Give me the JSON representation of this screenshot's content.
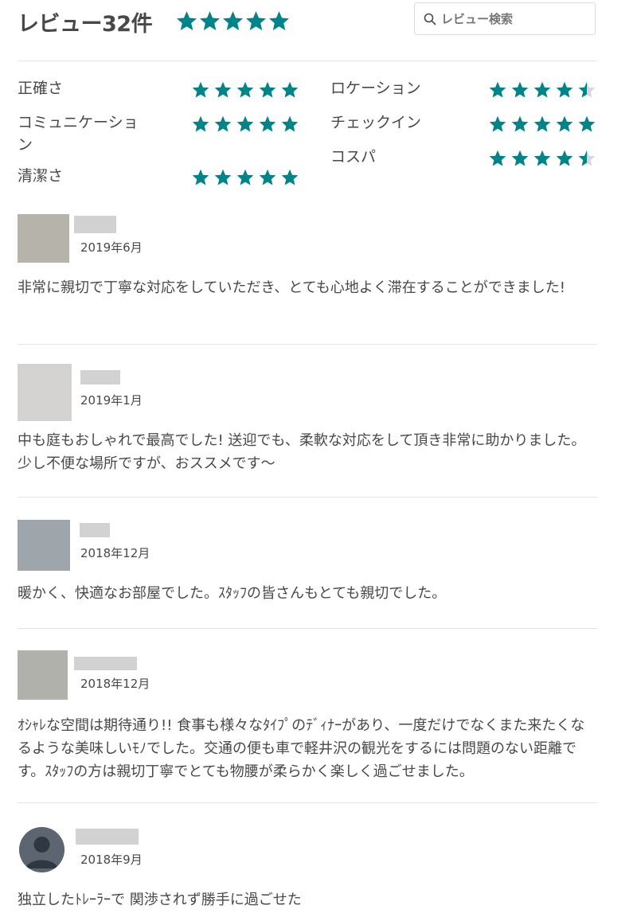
{
  "header": {
    "title": "レビュー32件",
    "overall_rating": 5,
    "search_placeholder": "レビュー検索"
  },
  "star_color": "#008489",
  "star_empty_color": "#d8d8d8",
  "categories": [
    {
      "label": "正確さ",
      "rating": 5
    },
    {
      "label": "コミュニケーション",
      "rating": 5
    },
    {
      "label": "清潔さ",
      "rating": 5
    },
    {
      "label": "ロケーション",
      "rating": 4.5
    },
    {
      "label": "チェックイン",
      "rating": 5
    },
    {
      "label": "コスパ",
      "rating": 4.5
    }
  ],
  "reviews": [
    {
      "date": "2019年6月",
      "text": "非常に親切で丁寧な対応をしていただき、とても心地よく滞在することができました!",
      "avatar_color": "#b6b3ab"
    },
    {
      "date": "2019年1月",
      "text": "中も庭もおしゃれで最高でした! 送迎でも、柔軟な対応をして頂き非常に助かりました。少し不便な場所ですが、おススメです〜",
      "avatar_color": "#d4d3d1"
    },
    {
      "date": "2018年12月",
      "text": "暖かく、快適なお部屋でした。ｽﾀｯﾌの皆さんもとても親切でした。",
      "avatar_color": "#9ea5ab"
    },
    {
      "date": "2018年12月",
      "text": "ｵｼｬﾚな空間は期待通り!! 食事も様々なﾀｲﾌﾟのﾃﾞｨﾅｰがあり、一度だけでなくまた来たくなるような美味しいﾓﾉでした。交通の便も車で軽井沢の観光をするには問題のない距離です。ｽﾀｯﾌの方は親切丁寧でとても物腰が柔らかく楽しく過ごせました。",
      "avatar_color": "#b1b1ab"
    },
    {
      "date": "2018年9月",
      "text": "独立したﾄﾚｰﾗｰで 関渉されず勝手に過ごせた",
      "avatar_color": "#5d6670"
    }
  ]
}
